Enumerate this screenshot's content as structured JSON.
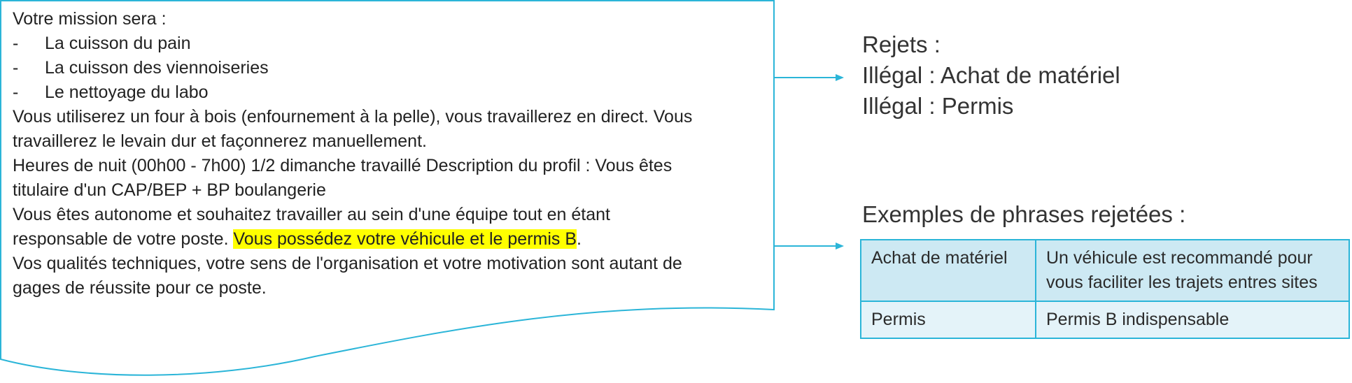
{
  "document": {
    "lines": [
      "Votre mission sera :",
      "La cuisson du pain",
      "La cuisson des viennoiseries",
      "Le nettoyage du labo",
      "Vous utiliserez un four à bois (enfournement à la pelle), vous travaillerez en direct. Vous",
      "travaillerez le levain dur et façonnerez manuellement.",
      "Heures de nuit (00h00 - 7h00) 1/2 dimanche travaillé Description du profil : Vous êtes",
      "titulaire d'un CAP/BEP + BP boulangerie",
      " Vous êtes autonome et souhaitez travailler au sein d'une équipe tout en étant",
      "responsable de votre poste. ",
      "Vous possédez votre véhicule et le permis B",
      ".",
      " Vos qualités techniques, votre sens de l'organisation et votre motivation sont autant de",
      "gages de réussite pour ce poste."
    ],
    "bullet_char": "-",
    "highlight_color": "#ffff00"
  },
  "rejets": {
    "title": "Rejets :",
    "items": [
      "Illégal : Achat de matériel",
      "Illégal : Permis"
    ]
  },
  "examples": {
    "title": "Exemples de phrases rejetées :",
    "rows": [
      {
        "category": "Achat de matériel",
        "phrase": "Un véhicule est recommandé pour vous faciliter les trajets entres sites"
      },
      {
        "category": "Permis",
        "phrase": "Permis B indispensable"
      }
    ]
  },
  "colors": {
    "accent": "#2bb5d8",
    "table_header_bg": "#cde9f3",
    "table_row_bg": "#e4f3f9"
  }
}
